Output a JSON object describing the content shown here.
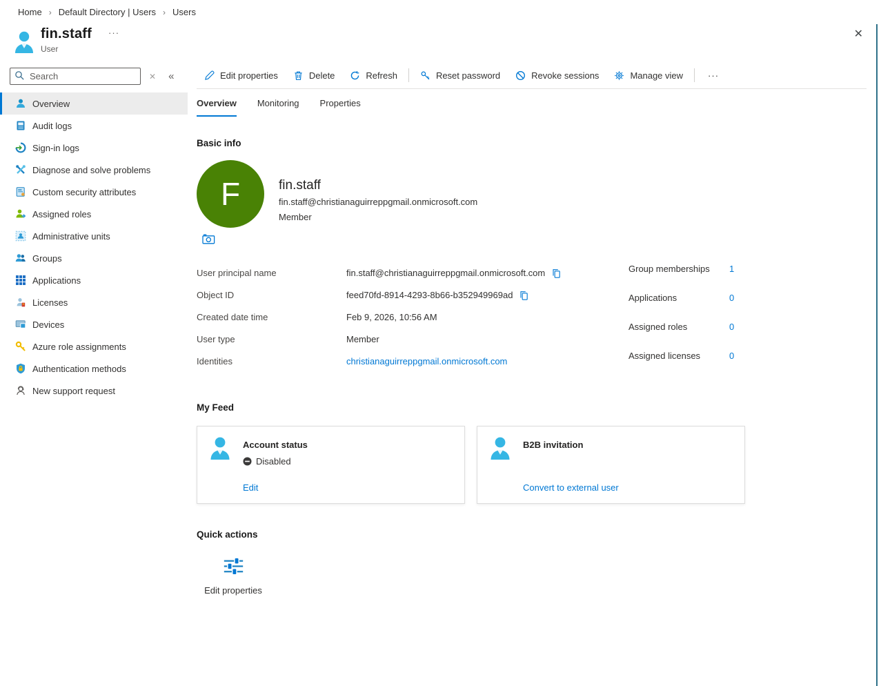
{
  "page": {
    "close_glyph": "✕"
  },
  "breadcrumb": {
    "separator": "›",
    "items": [
      "Home",
      "Default Directory | Users",
      "Users"
    ]
  },
  "header": {
    "title": "fin.staff",
    "subtitle": "User",
    "more_glyph": "···"
  },
  "sidebar": {
    "search": {
      "placeholder": "Search",
      "clear_glyph": "✕",
      "collapse_glyph": "«"
    },
    "items": [
      {
        "label": "Overview",
        "icon": "person-icon",
        "selected": true
      },
      {
        "label": "Audit logs",
        "icon": "audit-logs-icon"
      },
      {
        "label": "Sign-in logs",
        "icon": "sign-in-logs-icon"
      },
      {
        "label": "Diagnose and solve problems",
        "icon": "diagnose-icon"
      },
      {
        "label": "Custom security attributes",
        "icon": "security-attributes-icon"
      },
      {
        "label": "Assigned roles",
        "icon": "assigned-roles-icon"
      },
      {
        "label": "Administrative units",
        "icon": "admin-units-icon"
      },
      {
        "label": "Groups",
        "icon": "groups-icon"
      },
      {
        "label": "Applications",
        "icon": "applications-grid-icon"
      },
      {
        "label": "Licenses",
        "icon": "licenses-icon"
      },
      {
        "label": "Devices",
        "icon": "devices-icon"
      },
      {
        "label": "Azure role assignments",
        "icon": "key-icon"
      },
      {
        "label": "Authentication methods",
        "icon": "shield-lock-icon"
      },
      {
        "label": "New support request",
        "icon": "support-headset-icon"
      }
    ]
  },
  "toolbar": {
    "items": [
      "Edit properties",
      "Delete",
      "Refresh",
      "Reset password",
      "Revoke sessions",
      "Manage view"
    ],
    "more_glyph": "···"
  },
  "tabs": {
    "items": [
      "Overview",
      "Monitoring",
      "Properties"
    ],
    "active": "Overview"
  },
  "basic_info": {
    "heading": "Basic info",
    "avatar_letter": "F",
    "avatar_color": "#498205",
    "name": "fin.staff",
    "email": "fin.staff@christianaguirreppgmail.onmicrosoft.com",
    "membership": "Member",
    "fields": [
      {
        "label": "User principal name",
        "value": "fin.staff@christianaguirreppgmail.onmicrosoft.com",
        "copy": true
      },
      {
        "label": "Object ID",
        "value": "feed70fd-8914-4293-8b66-b352949969ad",
        "copy": true
      },
      {
        "label": "Created date time",
        "value": "Feb 9, 2026, 10:56 AM"
      },
      {
        "label": "User type",
        "value": "Member"
      },
      {
        "label": "Identities",
        "value": "christianaguirreppgmail.onmicrosoft.com",
        "link": true
      }
    ],
    "stats": [
      {
        "label": "Group memberships",
        "value": "1"
      },
      {
        "label": "Applications",
        "value": "0"
      },
      {
        "label": "Assigned roles",
        "value": "0"
      },
      {
        "label": "Assigned licenses",
        "value": "0"
      }
    ]
  },
  "my_feed": {
    "heading": "My Feed",
    "cards": [
      {
        "title": "Account status",
        "status": "Disabled",
        "action": "Edit"
      },
      {
        "title": "B2B invitation",
        "action": "Convert to external user"
      }
    ]
  },
  "quick_actions": {
    "heading": "Quick actions",
    "items": [
      {
        "label": "Edit properties"
      }
    ]
  },
  "colors": {
    "accent": "#0078d4",
    "avatar_green": "#498205",
    "blade_edge": "#2e7189"
  }
}
